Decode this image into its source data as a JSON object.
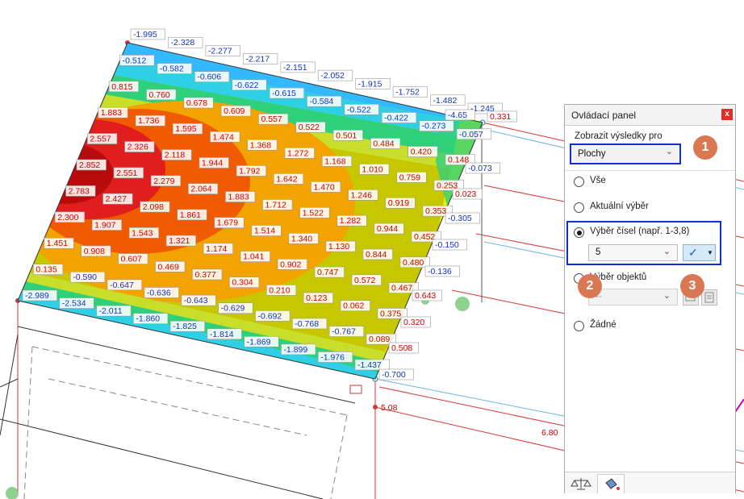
{
  "colors": {
    "badge": "#d97852",
    "highlight_box": "#0f30d0",
    "close_button": "#d9322b",
    "frame_line": "#d33a3a",
    "blue_label_text": "#1432c8",
    "red_label_text": "#d20000"
  },
  "viewport": {
    "corner_labels": [
      {
        "text": "-4.65",
        "pos": "top-right-corner"
      },
      {
        "text": "0.331",
        "pos": "right-node"
      },
      {
        "text": "-0.073",
        "pos": "right-member"
      },
      {
        "text": "0.023",
        "pos": "right-member"
      },
      {
        "text": "-0.305",
        "pos": "right-member"
      },
      {
        "text": "-0.150",
        "pos": "right-member"
      },
      {
        "text": "-0.136",
        "pos": "right-member"
      },
      {
        "text": "0.643",
        "pos": "right-member"
      },
      {
        "text": "0.320",
        "pos": "right-member"
      },
      {
        "text": "0.508",
        "pos": "right-member"
      },
      {
        "text": "-0.700",
        "pos": "bottom-right-node"
      },
      {
        "text": "5.08",
        "pos": "bottom-node"
      },
      {
        "text": "6.80",
        "pos": "far-node"
      },
      {
        "text": "-2.989",
        "pos": "left-node"
      },
      {
        "text": "-1.995",
        "pos": "top-node"
      }
    ],
    "rows": [
      [
        "-1.995",
        "-2.328",
        "-2.277",
        "-2.217",
        "-2.151",
        "-2.052",
        "-1.915",
        "-1.752",
        "-1.482",
        "-1.245"
      ],
      [
        "-0.512",
        "-0.582",
        "-0.606",
        "-0.622",
        "-0.615",
        "-0.584",
        "-0.522",
        "-0.422",
        "-0.273",
        "-0.057"
      ],
      [
        "0.815",
        "0.760",
        "0.678",
        "0.609",
        "0.557",
        "0.522",
        "0.501",
        "0.484",
        "0.420",
        "0.148"
      ],
      [
        "1.883",
        "1.736",
        "1.595",
        "1.474",
        "1.368",
        "1.272",
        "1.168",
        "1.010",
        "0.759",
        "0.253"
      ],
      [
        "2.557",
        "2.326",
        "2.118",
        "1.944",
        "1.792",
        "1.642",
        "1.470",
        "1.246",
        "0.919",
        "0.353"
      ],
      [
        "2.852",
        "2.551",
        "2.279",
        "2.064",
        "1.883",
        "1.712",
        "1.522",
        "1.282",
        "0.944",
        "0.452"
      ],
      [
        "2.783",
        "2.427",
        "2.098",
        "1.861",
        "1.679",
        "1.514",
        "1.340",
        "1.130",
        "0.844",
        "0.480"
      ],
      [
        "2.300",
        "1.907",
        "1.543",
        "1.321",
        "1.174",
        "1.041",
        "0.902",
        "0.747",
        "0.572",
        "0.467"
      ],
      [
        "1.451",
        "0.908",
        "0.607",
        "0.469",
        "0.377",
        "0.304",
        "0.210",
        "0.123",
        "0.062",
        "0.375"
      ],
      [
        "0.135",
        "-0.590",
        "-0.647",
        "-0.636",
        "-0.643",
        "-0.629",
        "-0.692",
        "-0.768",
        "-0.767",
        "0.089"
      ],
      [
        "-2.989",
        "-2.534",
        "-2.011",
        "-1.860",
        "-1.825",
        "-1.814",
        "-1.869",
        "-1.899",
        "-1.976",
        "-1.437"
      ]
    ]
  },
  "panel": {
    "title": "Ovládací panel",
    "close_label": "x",
    "show_results_label": "Zobrazit výsledky pro",
    "show_results_value": "Plochy",
    "radio_options": [
      {
        "label": "Vše",
        "selected": false
      },
      {
        "label": "Aktuální výběr",
        "selected": false
      },
      {
        "label": "Výběr čísel (např. 1-3,8)",
        "selected": true
      },
      {
        "label": "Výběr objektů",
        "selected": false
      },
      {
        "label": "Žádné",
        "selected": false
      }
    ],
    "number_value": "5",
    "object_value": "--"
  },
  "badges": [
    "1",
    "2",
    "3"
  ]
}
